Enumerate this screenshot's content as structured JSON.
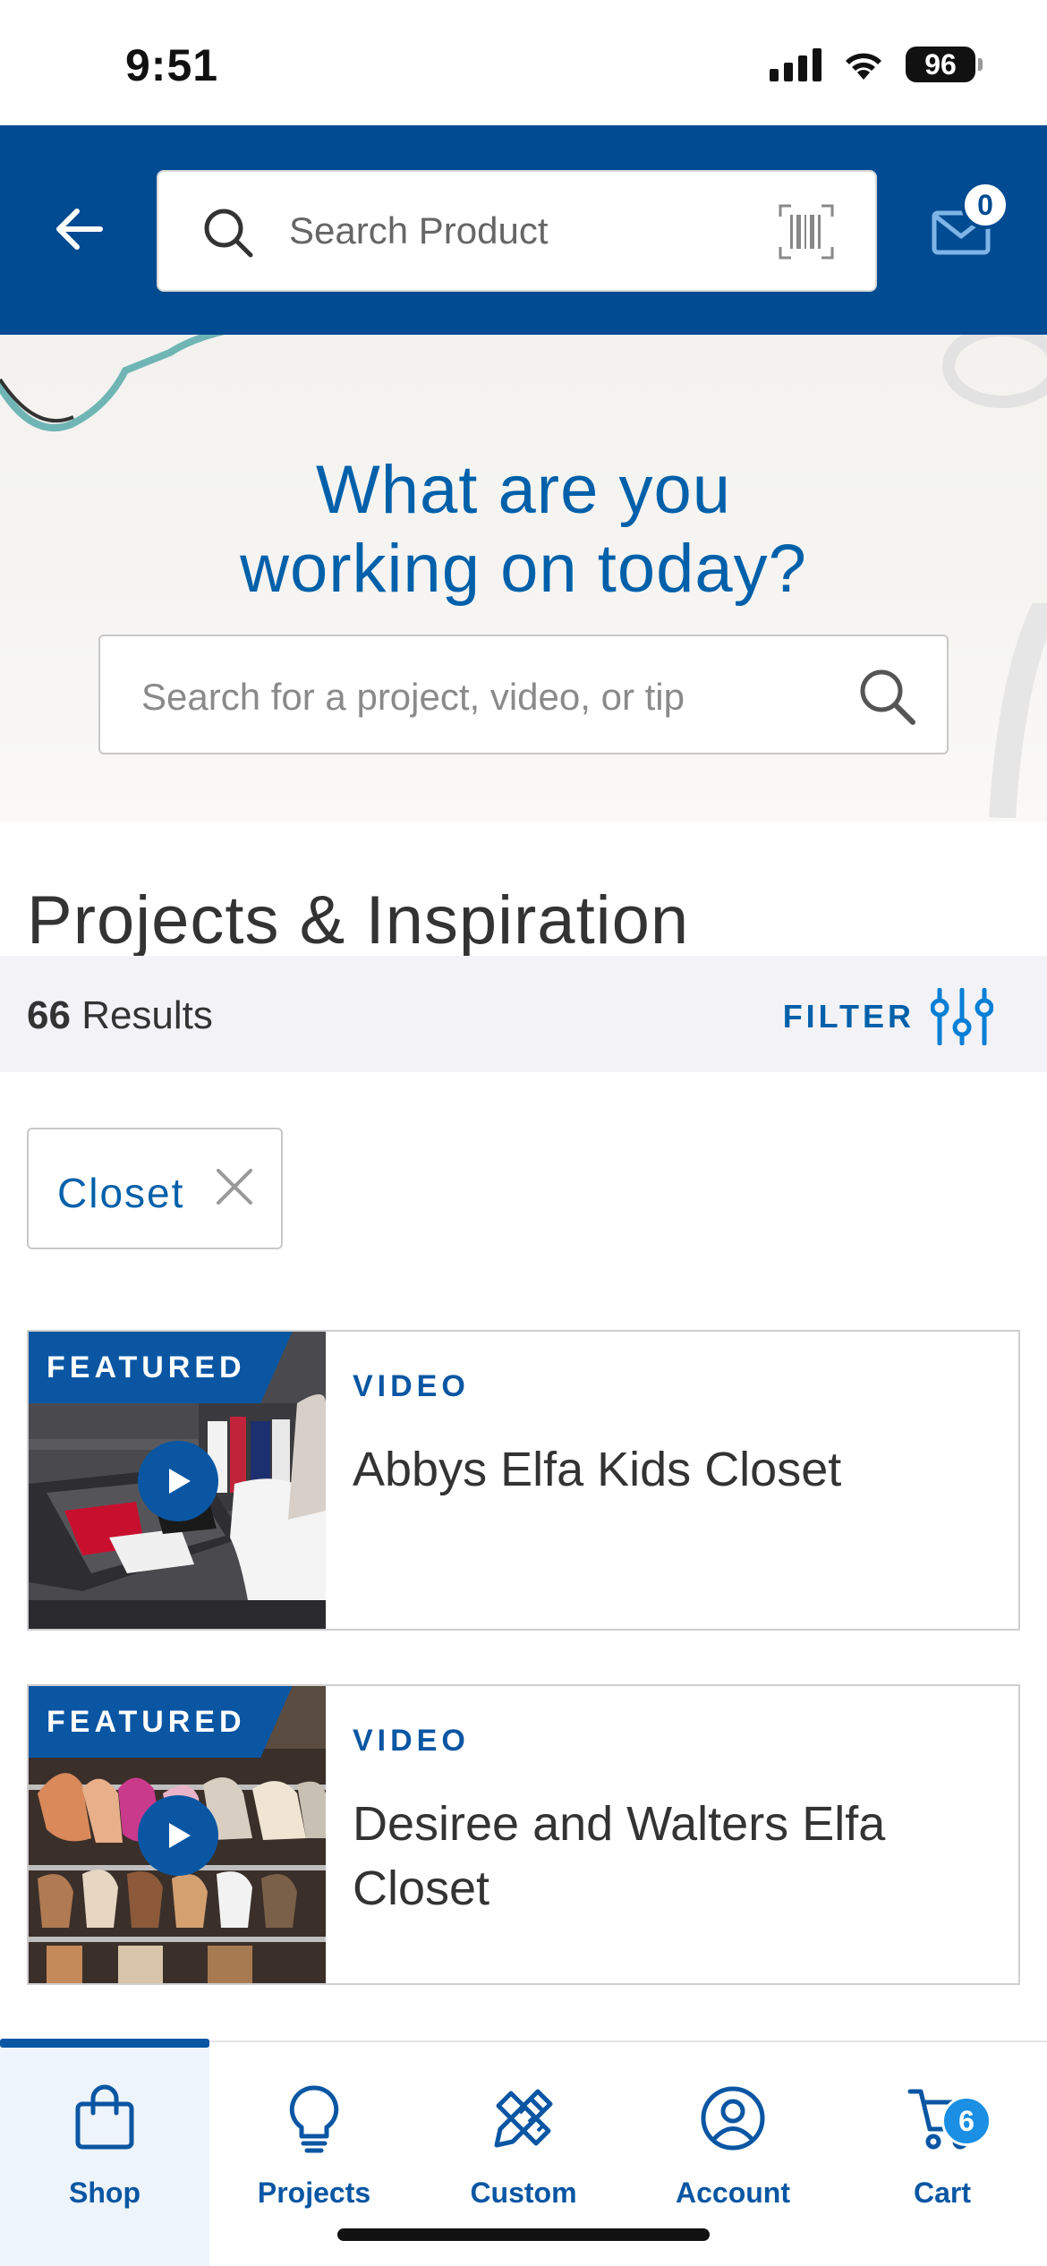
{
  "status_bar": {
    "time": "9:51",
    "battery": "96",
    "icons": [
      "signal-icon",
      "wifi-icon",
      "battery-icon"
    ]
  },
  "header": {
    "search_placeholder": "Search Product",
    "mail_badge": "0",
    "icons": [
      "back-arrow-icon",
      "search-icon",
      "barcode-icon",
      "mail-icon"
    ],
    "background": "#004b91"
  },
  "hero": {
    "title_line1": "What are you",
    "title_line2": "working on today?",
    "search_placeholder": "Search for a project, video, or tip"
  },
  "section": {
    "title": "Projects & Inspiration"
  },
  "results": {
    "count": "66",
    "label": "Results",
    "filter_label": "FILTER"
  },
  "chip": {
    "label": "Closet"
  },
  "cards": [
    {
      "tag": "FEATURED",
      "type": "VIDEO",
      "title": "Abbys Elfa Kids Closet"
    },
    {
      "tag": "FEATURED",
      "type": "VIDEO",
      "title": "Desiree and Walters Elfa Closet"
    }
  ],
  "bottom_nav": {
    "items": [
      {
        "label": "Shop",
        "icon": "shopping-bag-icon",
        "active": true
      },
      {
        "label": "Projects",
        "icon": "lightbulb-icon",
        "active": false
      },
      {
        "label": "Custom",
        "icon": "pencil-ruler-icon",
        "active": false
      },
      {
        "label": "Account",
        "icon": "user-circle-icon",
        "active": false
      },
      {
        "label": "Cart",
        "icon": "cart-icon",
        "active": false
      }
    ],
    "cart_badge": "6"
  },
  "colors": {
    "brand_blue": "#004b91",
    "accent_blue": "#0060a9",
    "badge_blue": "#1a8fe3"
  }
}
